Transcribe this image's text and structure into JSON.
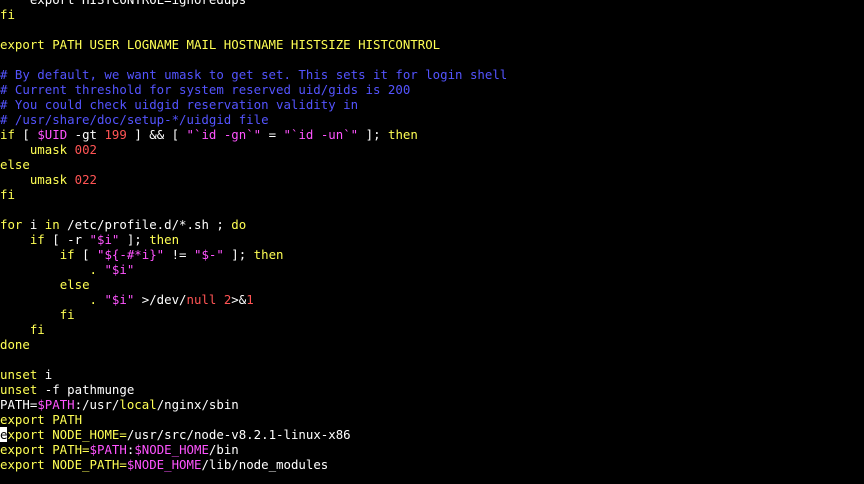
{
  "colors": {
    "background": "#000000",
    "text": "#ffffff",
    "keyword": "#ffff54",
    "comment": "#5454ff",
    "string": "#ff54ff",
    "variable": "#ff54ff",
    "number": "#ff5454",
    "cursor": "#ffffff"
  },
  "editor": {
    "cursor": {
      "line": 29,
      "column": 0
    },
    "lines": [
      [
        {
          "t": "    export HISTCONTROL=ignoredups",
          "c": "d"
        }
      ],
      [
        {
          "t": "fi",
          "c": "k"
        }
      ],
      [],
      [
        {
          "t": "export PATH USER LOGNAME MAIL HOSTNAME HISTSIZE HISTCONTROL",
          "c": "k"
        }
      ],
      [],
      [
        {
          "t": "# By default, we want umask to get set. This sets it for login shell",
          "c": "c"
        }
      ],
      [
        {
          "t": "# Current threshold for system reserved uid/gids is 200",
          "c": "c"
        }
      ],
      [
        {
          "t": "# You could check uidgid reservation validity in",
          "c": "c"
        }
      ],
      [
        {
          "t": "# /usr/share/doc/setup-*/uidgid file",
          "c": "c"
        }
      ],
      [
        {
          "t": "if",
          "c": "k"
        },
        {
          "t": " [ ",
          "c": "d"
        },
        {
          "t": "$UID",
          "c": "v"
        },
        {
          "t": " -gt ",
          "c": "d"
        },
        {
          "t": "199",
          "c": "n"
        },
        {
          "t": " ] && [ ",
          "c": "d"
        },
        {
          "t": "\"`id -gn`\"",
          "c": "s"
        },
        {
          "t": " = ",
          "c": "d"
        },
        {
          "t": "\"`id -un`\"",
          "c": "s"
        },
        {
          "t": " ]; ",
          "c": "d"
        },
        {
          "t": "then",
          "c": "k"
        }
      ],
      [
        {
          "t": "    umask ",
          "c": "k"
        },
        {
          "t": "002",
          "c": "n"
        }
      ],
      [
        {
          "t": "else",
          "c": "k"
        }
      ],
      [
        {
          "t": "    umask ",
          "c": "k"
        },
        {
          "t": "022",
          "c": "n"
        }
      ],
      [
        {
          "t": "fi",
          "c": "k"
        }
      ],
      [],
      [
        {
          "t": "for",
          "c": "k"
        },
        {
          "t": " i ",
          "c": "d"
        },
        {
          "t": "in",
          "c": "k"
        },
        {
          "t": " /etc/profile.d/*.sh ; ",
          "c": "d"
        },
        {
          "t": "do",
          "c": "k"
        }
      ],
      [
        {
          "t": "    ",
          "c": "d"
        },
        {
          "t": "if",
          "c": "k"
        },
        {
          "t": " [ -r ",
          "c": "d"
        },
        {
          "t": "\"$i\"",
          "c": "s"
        },
        {
          "t": " ]; ",
          "c": "d"
        },
        {
          "t": "then",
          "c": "k"
        }
      ],
      [
        {
          "t": "        ",
          "c": "d"
        },
        {
          "t": "if",
          "c": "k"
        },
        {
          "t": " [ ",
          "c": "d"
        },
        {
          "t": "\"${-#*i}\"",
          "c": "s"
        },
        {
          "t": " != ",
          "c": "d"
        },
        {
          "t": "\"$-\"",
          "c": "s"
        },
        {
          "t": " ]; ",
          "c": "d"
        },
        {
          "t": "then",
          "c": "k"
        }
      ],
      [
        {
          "t": "            . ",
          "c": "k"
        },
        {
          "t": "\"$i\"",
          "c": "s"
        }
      ],
      [
        {
          "t": "        ",
          "c": "d"
        },
        {
          "t": "else",
          "c": "k"
        }
      ],
      [
        {
          "t": "            . ",
          "c": "k"
        },
        {
          "t": "\"$i\"",
          "c": "s"
        },
        {
          "t": " >/dev/",
          "c": "d"
        },
        {
          "t": "null",
          "c": "n"
        },
        {
          "t": " ",
          "c": "d"
        },
        {
          "t": "2",
          "c": "n"
        },
        {
          "t": ">&",
          "c": "d"
        },
        {
          "t": "1",
          "c": "n"
        }
      ],
      [
        {
          "t": "        ",
          "c": "d"
        },
        {
          "t": "fi",
          "c": "k"
        }
      ],
      [
        {
          "t": "    ",
          "c": "d"
        },
        {
          "t": "fi",
          "c": "k"
        }
      ],
      [
        {
          "t": "done",
          "c": "k"
        }
      ],
      [],
      [
        {
          "t": "unset",
          "c": "k"
        },
        {
          "t": " i",
          "c": "d"
        }
      ],
      [
        {
          "t": "unset",
          "c": "k"
        },
        {
          "t": " -f pathmunge",
          "c": "d"
        }
      ],
      [
        {
          "t": "PATH=",
          "c": "d"
        },
        {
          "t": "$PATH",
          "c": "v"
        },
        {
          "t": ":/usr/",
          "c": "d"
        },
        {
          "t": "local",
          "c": "k"
        },
        {
          "t": "/nginx/sbin",
          "c": "d"
        }
      ],
      [
        {
          "t": "export PATH",
          "c": "k"
        }
      ],
      [
        {
          "t": "export NODE_HOME=",
          "c": "k"
        },
        {
          "t": "/usr/src/node-v8.2.1-linux-x86",
          "c": "d"
        }
      ],
      [
        {
          "t": "export PATH=",
          "c": "k"
        },
        {
          "t": "$PATH",
          "c": "v"
        },
        {
          "t": ":",
          "c": "d"
        },
        {
          "t": "$NODE_HOME",
          "c": "v"
        },
        {
          "t": "/bin",
          "c": "d"
        }
      ],
      [
        {
          "t": "export NODE_PATH=",
          "c": "k"
        },
        {
          "t": "$NODE_HOME",
          "c": "v"
        },
        {
          "t": "/lib/node_modules",
          "c": "d"
        }
      ]
    ]
  }
}
